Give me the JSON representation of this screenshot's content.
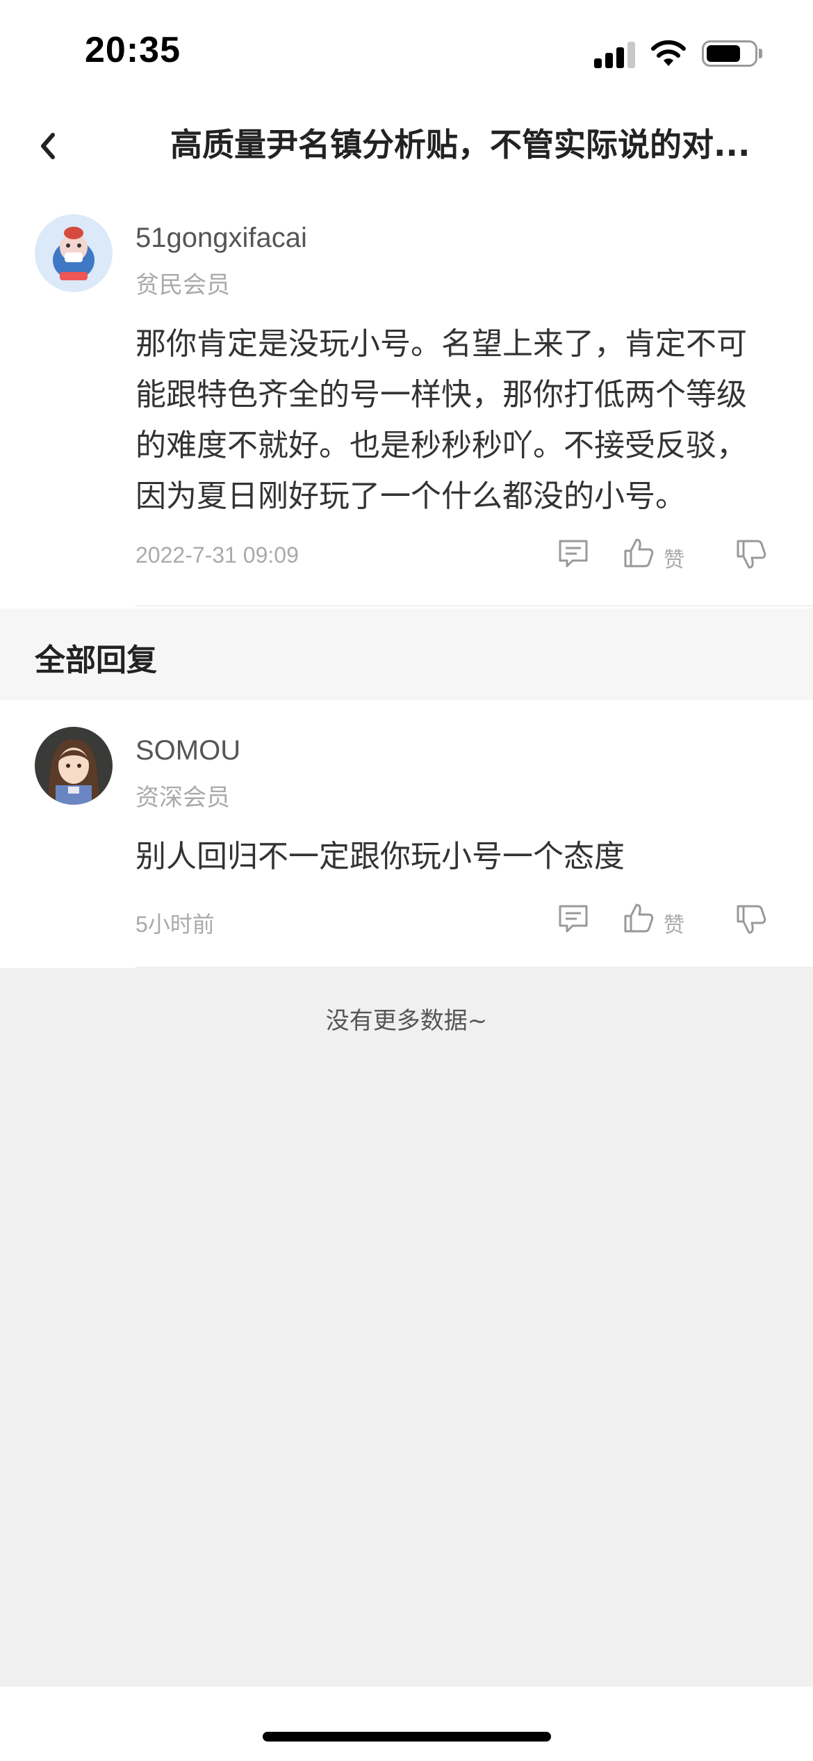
{
  "status_bar": {
    "time": "20:35"
  },
  "header": {
    "title": "高质量尹名镇分析贴，不管实际说的对..."
  },
  "post": {
    "username": "51gongxifacai",
    "rank": "贫民会员",
    "content": "那你肯定是没玩小号。名望上来了，肯定不可能跟特色齐全的号一样快，那你打低两个等级的难度不就好。也是秒秒秒吖。不接受反驳，因为夏日刚好玩了一个什么都没的小号。",
    "time": "2022-7-31 09:09",
    "like_label": "赞"
  },
  "section": {
    "title": "全部回复"
  },
  "reply": {
    "username": "SOMOU",
    "rank": "资深会员",
    "content": "别人回归不一定跟你玩小号一个态度",
    "time": "5小时前",
    "like_label": "赞"
  },
  "footer": {
    "no_more": "没有更多数据~"
  },
  "icons": {
    "back": "chevron-left-icon",
    "comment": "comment-icon",
    "like": "thumbs-up-icon",
    "dislike": "thumbs-down-icon"
  }
}
